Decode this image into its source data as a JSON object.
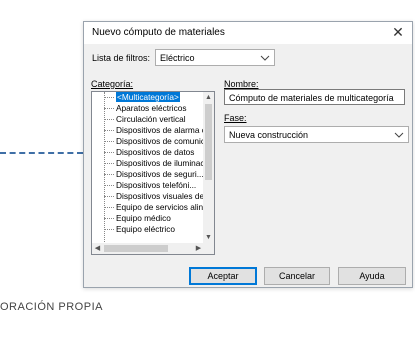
{
  "caption": "ORACIÓN PROPIA",
  "dialog": {
    "title": "Nuevo cómputo de materiales",
    "close_glyph": "✕",
    "filter_label": "Lista de filtros:",
    "filter_value": "Eléctrico",
    "category_label": "Categoría:",
    "name_label": "Nombre:",
    "name_value": "Cómputo de materiales de multicategoría",
    "phase_label": "Fase:",
    "phase_value": "Nueva construcción",
    "categories": [
      "<Multicategoría>",
      "Aparatos eléctricos",
      "Circulación vertical",
      "Dispositivos de alarma c",
      "Dispositivos de comunic",
      "Dispositivos de datos",
      "Dispositivos de iluminac",
      "Dispositivos de seguri...",
      "Dispositivos telefóni...",
      "Dispositivos visuales de",
      "Equipo de servicios alin",
      "Equipo médico",
      "Equipo eléctrico"
    ],
    "selected_category_index": 0,
    "buttons": {
      "accept": "Aceptar",
      "cancel": "Cancelar",
      "help": "Ayuda"
    }
  },
  "colors": {
    "selection": "#0078d7",
    "dash_accent": "#3f6fa6"
  }
}
